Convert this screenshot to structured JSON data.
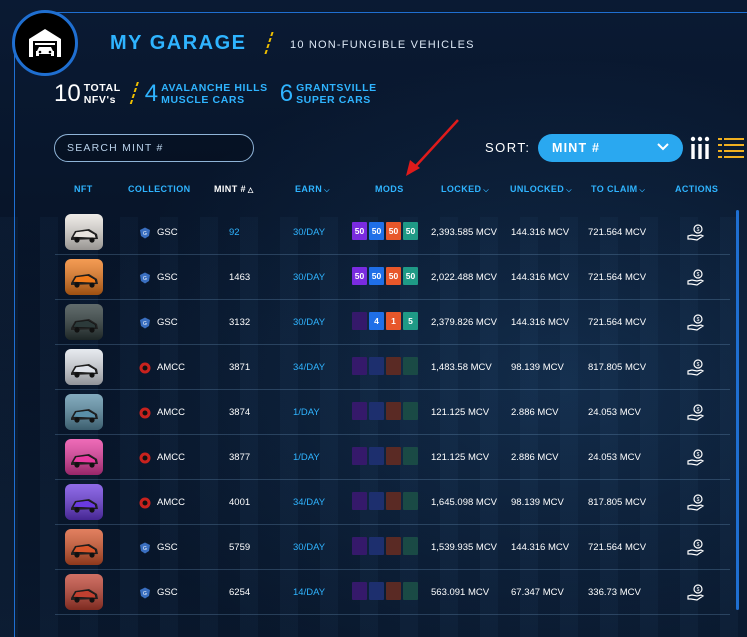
{
  "header": {
    "title": "MY GARAGE",
    "subtitle": "10 NON-FUNGIBLE VEHICLES",
    "logo_icon": "garage-car-icon"
  },
  "stats": [
    {
      "number": "10",
      "label_line1": "TOTAL",
      "label_line2": "NFV's",
      "style": "white"
    },
    {
      "number": "4",
      "label_line1": "AVALANCHE HILLS",
      "label_line2": "MUSCLE CARS",
      "style": "blue"
    },
    {
      "number": "6",
      "label_line1": "GRANTSVILLE",
      "label_line2": "SUPER CARS",
      "style": "blue"
    }
  ],
  "search": {
    "placeholder": "SEARCH MINT #"
  },
  "sort": {
    "label": "SORT:",
    "selected": "MINT #"
  },
  "columns": {
    "nft": "NFT",
    "collection": "COLLECTION",
    "mint": "MINT #",
    "earn": "EARN",
    "mods": "MODS",
    "locked": "LOCKED",
    "unlocked": "UNLOCKED",
    "to_claim": "TO CLAIM",
    "actions": "ACTIONS"
  },
  "colors": {
    "accent": "#2fb4ff",
    "frame": "#1f6fd1",
    "mod_purple": "#7a2be0",
    "mod_blue": "#1f6fe8",
    "mod_orange": "#e8572a",
    "mod_teal": "#1f9a86",
    "annotation_arrow": "#e01b1b"
  },
  "rows": [
    {
      "car_color": "#e8e4df",
      "collection": "GSC",
      "coll_icon": "gsc-badge-icon",
      "mint": "92",
      "mint_highlight": true,
      "earn": "30/DAY",
      "mods": [
        "50",
        "50",
        "50",
        "50"
      ],
      "mods_active": [
        true,
        true,
        true,
        true
      ],
      "locked": "2,393.585 MCV",
      "unlocked": "144.316 MCV",
      "to_claim": "721.564 MCV"
    },
    {
      "car_color": "#f07a1a",
      "collection": "GSC",
      "coll_icon": "gsc-badge-icon",
      "mint": "1463",
      "mint_highlight": false,
      "earn": "30/DAY",
      "mods": [
        "50",
        "50",
        "50",
        "50"
      ],
      "mods_active": [
        true,
        true,
        true,
        true
      ],
      "locked": "2,022.488 MCV",
      "unlocked": "144.316 MCV",
      "to_claim": "721.564 MCV"
    },
    {
      "car_color": "#2c3a3a",
      "collection": "GSC",
      "coll_icon": "gsc-badge-icon",
      "mint": "3132",
      "mint_highlight": false,
      "earn": "30/DAY",
      "mods": [
        "",
        "4",
        "1",
        "5"
      ],
      "mods_active": [
        false,
        true,
        true,
        true
      ],
      "locked": "2,379.826 MCV",
      "unlocked": "144.316 MCV",
      "to_claim": "721.564 MCV"
    },
    {
      "car_color": "#dfe3ea",
      "collection": "AMCC",
      "coll_icon": "amcc-badge-icon",
      "mint": "3871",
      "mint_highlight": false,
      "earn": "34/DAY",
      "mods": [
        "",
        "",
        "",
        ""
      ],
      "mods_active": [
        false,
        false,
        false,
        false
      ],
      "locked": "1,483.58 MCV",
      "unlocked": "98.139 MCV",
      "to_claim": "817.805 MCV"
    },
    {
      "car_color": "#5a8fa8",
      "collection": "AMCC",
      "coll_icon": "amcc-badge-icon",
      "mint": "3874",
      "mint_highlight": false,
      "earn": "1/DAY",
      "mods": [
        "",
        "",
        "",
        ""
      ],
      "mods_active": [
        false,
        false,
        false,
        false
      ],
      "locked": "121.125 MCV",
      "unlocked": "2.886 MCV",
      "to_claim": "24.053 MCV"
    },
    {
      "car_color": "#e83aa0",
      "collection": "AMCC",
      "coll_icon": "amcc-badge-icon",
      "mint": "3877",
      "mint_highlight": false,
      "earn": "1/DAY",
      "mods": [
        "",
        "",
        "",
        ""
      ],
      "mods_active": [
        false,
        false,
        false,
        false
      ],
      "locked": "121.125 MCV",
      "unlocked": "2.886 MCV",
      "to_claim": "24.053 MCV"
    },
    {
      "car_color": "#6a3ae0",
      "collection": "AMCC",
      "coll_icon": "amcc-badge-icon",
      "mint": "4001",
      "mint_highlight": false,
      "earn": "34/DAY",
      "mods": [
        "",
        "",
        "",
        ""
      ],
      "mods_active": [
        false,
        false,
        false,
        false
      ],
      "locked": "1,645.098 MCV",
      "unlocked": "98.139 MCV",
      "to_claim": "817.805 MCV"
    },
    {
      "car_color": "#d8552a",
      "collection": "GSC",
      "coll_icon": "gsc-badge-icon",
      "mint": "5759",
      "mint_highlight": false,
      "earn": "30/DAY",
      "mods": [
        "",
        "",
        "",
        ""
      ],
      "mods_active": [
        false,
        false,
        false,
        false
      ],
      "locked": "1,539.935 MCV",
      "unlocked": "144.316 MCV",
      "to_claim": "721.564 MCV"
    },
    {
      "car_color": "#c04030",
      "collection": "GSC",
      "coll_icon": "gsc-badge-icon",
      "mint": "6254",
      "mint_highlight": false,
      "earn": "14/DAY",
      "mods": [
        "",
        "",
        "",
        ""
      ],
      "mods_active": [
        false,
        false,
        false,
        false
      ],
      "locked": "563.091 MCV",
      "unlocked": "67.347 MCV",
      "to_claim": "336.73 MCV"
    }
  ]
}
